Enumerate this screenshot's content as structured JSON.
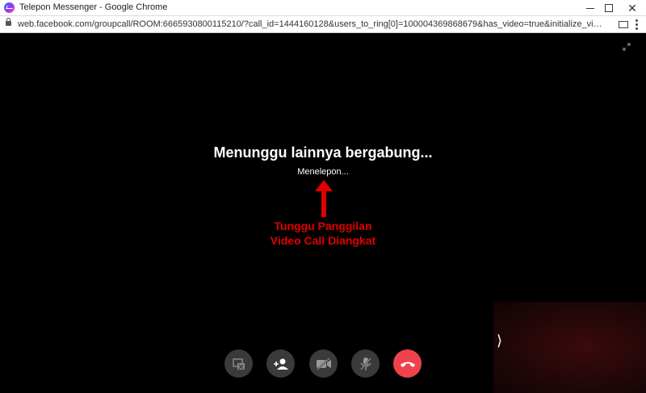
{
  "window": {
    "title": "Telepon Messenger - Google Chrome"
  },
  "address_bar": {
    "url": "web.facebook.com/groupcall/ROOM:6665930800115210/?call_id=1444160128&users_to_ring[0]=100004369868679&has_video=true&initialize_video=true&nonce=z0uqnir2hggi&thread_ty..."
  },
  "call": {
    "status_title": "Menunggu lainnya bergabung...",
    "status_subtitle": "Menelepon..."
  },
  "annotation": {
    "line1": "Tunggu Panggilan",
    "line2": "Video Call Diangkat",
    "color": "#e00000"
  },
  "controls": [
    {
      "icon": "screen-share-off-icon"
    },
    {
      "icon": "add-person-icon"
    },
    {
      "icon": "video-off-icon"
    },
    {
      "icon": "mic-off-icon"
    },
    {
      "icon": "end-call-icon",
      "color": "#f0424d"
    }
  ],
  "self_view": {
    "toggle_glyph": "⟩"
  }
}
